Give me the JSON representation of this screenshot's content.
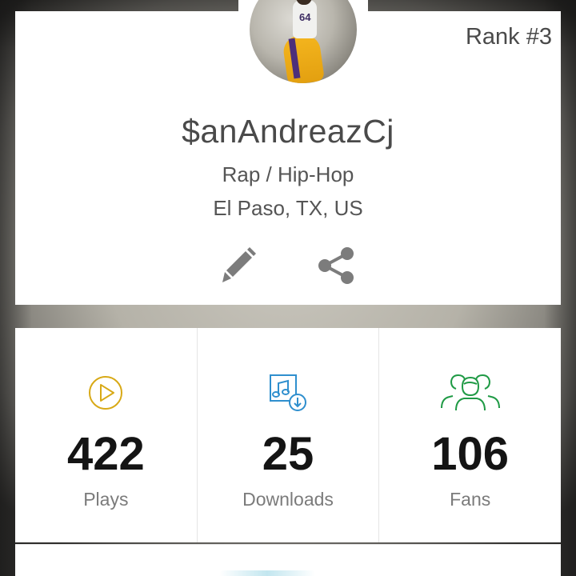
{
  "profile": {
    "rank": "Rank #3",
    "username": "$anAndreazCj",
    "genre": "Rap / Hip-Hop",
    "location": "El Paso, TX, US",
    "avatar_jersey_number": "64",
    "actions": [
      {
        "name": "edit",
        "icon": "pencil-icon"
      },
      {
        "name": "share",
        "icon": "share-icon"
      }
    ]
  },
  "stats": [
    {
      "value": "422",
      "label": "Plays",
      "icon": "play-circle-icon",
      "color": "#d8a916"
    },
    {
      "value": "25",
      "label": "Downloads",
      "icon": "music-download-icon",
      "color": "#2f8fce"
    },
    {
      "value": "106",
      "label": "Fans",
      "icon": "fans-icon",
      "color": "#1f9a45"
    }
  ],
  "colors": {
    "card": "#ffffff",
    "text_primary": "#141414",
    "text_secondary": "#7b7b7b",
    "icon_gray": "#7c7c7c"
  }
}
